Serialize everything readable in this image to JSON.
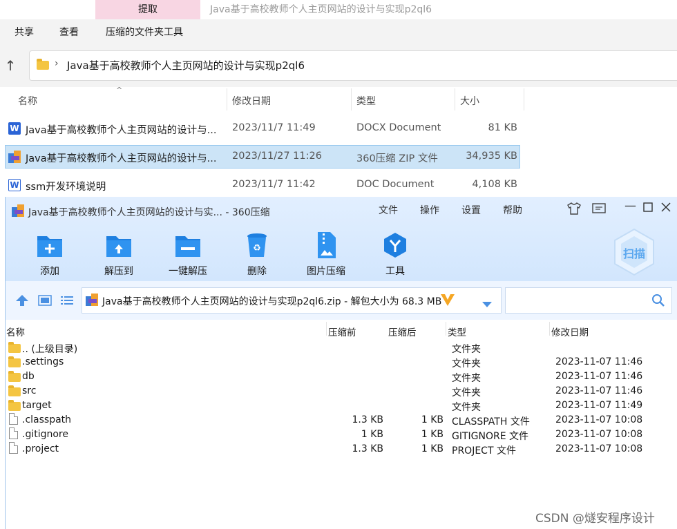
{
  "explorer": {
    "extract_tab": "提取",
    "window_title": "Java基于高校教师个人主页网站的设计与实现p2ql6",
    "ribbon_tabs": [
      "共享",
      "查看",
      "压缩的文件夹工具"
    ],
    "address_path": "Java基于高校教师个人主页网站的设计与实现p2ql6",
    "columns": [
      "名称",
      "修改日期",
      "类型",
      "大小"
    ],
    "files": [
      {
        "name": "Java基于高校教师个人主页网站的设计与...",
        "date": "2023/11/7 11:49",
        "type": "DOCX Document",
        "size": "81 KB",
        "icon": "word-docx-icon",
        "selected": false
      },
      {
        "name": "Java基于高校教师个人主页网站的设计与...",
        "date": "2023/11/27 11:26",
        "type": "360压缩 ZIP 文件",
        "size": "34,935 KB",
        "icon": "zip-archive-icon",
        "selected": true
      },
      {
        "name": "ssm开发环境说明",
        "date": "2023/11/7 11:42",
        "type": "DOC Document",
        "size": "4,108 KB",
        "icon": "word-doc-icon",
        "selected": false
      }
    ]
  },
  "archiver": {
    "title": "Java基于高校教师个人主页网站的设计与实... - 360压缩",
    "menu": [
      "文件",
      "操作",
      "设置",
      "帮助"
    ],
    "toolbar": [
      "添加",
      "解压到",
      "一键解压",
      "删除",
      "图片压缩",
      "工具"
    ],
    "scan_label": "扫描",
    "path": "Java基于高校教师个人主页网站的设计与实现p2ql6.zip - 解包大小为 68.3 MB",
    "columns": [
      "名称",
      "压缩前",
      "压缩后",
      "类型",
      "修改日期"
    ],
    "rows": [
      {
        "name": ".. (上级目录)",
        "before": "",
        "after": "",
        "type": "文件夹",
        "date": "",
        "kind": "folder"
      },
      {
        "name": ".settings",
        "before": "",
        "after": "",
        "type": "文件夹",
        "date": "2023-11-07 11:46",
        "kind": "folder"
      },
      {
        "name": "db",
        "before": "",
        "after": "",
        "type": "文件夹",
        "date": "2023-11-07 11:46",
        "kind": "folder"
      },
      {
        "name": "src",
        "before": "",
        "after": "",
        "type": "文件夹",
        "date": "2023-11-07 11:46",
        "kind": "folder"
      },
      {
        "name": "target",
        "before": "",
        "after": "",
        "type": "文件夹",
        "date": "2023-11-07 11:49",
        "kind": "folder"
      },
      {
        "name": ".classpath",
        "before": "1.3 KB",
        "after": "1 KB",
        "type": "CLASSPATH 文件",
        "date": "2023-11-07 10:08",
        "kind": "file"
      },
      {
        "name": ".gitignore",
        "before": "1 KB",
        "after": "1 KB",
        "type": "GITIGNORE 文件",
        "date": "2023-11-07 10:08",
        "kind": "file"
      },
      {
        "name": ".project",
        "before": "1.3 KB",
        "after": "1 KB",
        "type": "PROJECT 文件",
        "date": "2023-11-07 10:08",
        "kind": "file"
      }
    ]
  },
  "watermark": "CSDN @燧安程序设计",
  "colors": {
    "accent_blue": "#1e7fe0",
    "selection": "#cce4f7",
    "extract_tab": "#f8d6e3"
  }
}
